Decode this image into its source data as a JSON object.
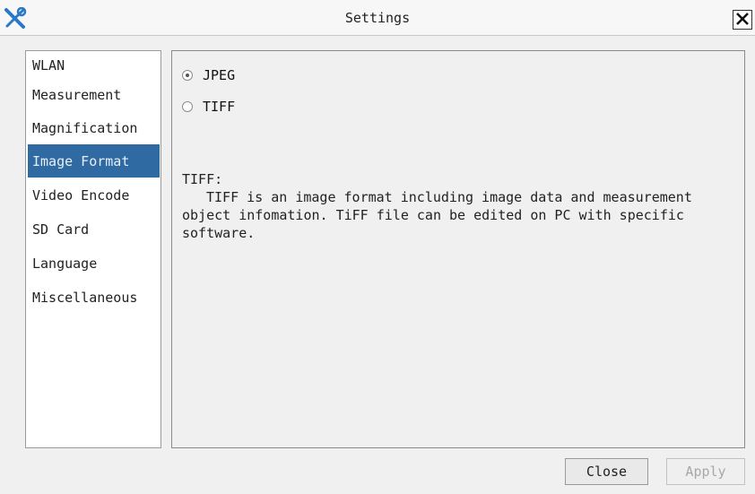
{
  "window": {
    "title": "Settings",
    "app_icon": "tools-icon",
    "close_icon": "close-icon"
  },
  "sidebar": {
    "items": [
      {
        "label": "WLAN",
        "selected": false
      },
      {
        "label": "Measurement",
        "selected": false
      },
      {
        "label": "Magnification",
        "selected": false
      },
      {
        "label": "Image Format",
        "selected": true
      },
      {
        "label": "Video Encode",
        "selected": false
      },
      {
        "label": "SD Card",
        "selected": false
      },
      {
        "label": "Language",
        "selected": false
      },
      {
        "label": "Miscellaneous",
        "selected": false
      }
    ],
    "selected_color": "#2f6aa3"
  },
  "image_format": {
    "options": [
      {
        "label": "JPEG",
        "checked": true
      },
      {
        "label": "TIFF",
        "checked": false
      }
    ],
    "description_title": "TIFF:",
    "description": "TIFF is an image format including image data and measurement object infomation. TiFF file can be edited on PC with specific software."
  },
  "buttons": {
    "close": "Close",
    "apply": "Apply"
  }
}
